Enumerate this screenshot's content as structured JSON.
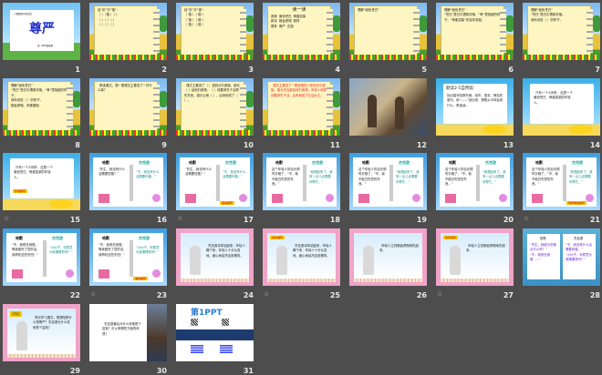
{
  "view": "slide-sorter",
  "animation_icon": "☆",
  "slides": [
    {
      "n": "1",
      "type": "title",
      "title": "尊严",
      "subtitle": "第一PPT模板网",
      "header": "人教版四年级语文"
    },
    {
      "n": "2",
      "type": "notebook",
      "text": "给“饥”字“饿”：\n（ ）（饿 ）（ ）\n（ ）（ ）（ ）\n（ ）（ ）（ ）"
    },
    {
      "n": "3",
      "type": "notebook",
      "text": "给“饥”字“饿”：\n（ 饿 ）（ 饿 ）\n（ 饿 ）（ 饿 ）\n（ 饿 ）（ 饿 ）"
    },
    {
      "n": "4",
      "type": "notebook",
      "heading": "读一读",
      "text": "逃难  面色苍白  骨瘦如柴\n款待  狼吞虎咽  慈祥\n捶背  尊严  庄园"
    },
    {
      "n": "5",
      "type": "notebook",
      "text": "理解“面色苍白”"
    },
    {
      "n": "6",
      "type": "notebook",
      "text": "理解“面色苍白”\n“苍白”是白中透着灰暗，“骨”是指瘦的样子。“骨瘦如柴”形容非常瘦。"
    },
    {
      "n": "7",
      "type": "notebook",
      "text": "理解“面色苍白”\n“苍白”是白中透着灰暗。\n请你说说（ ）的样子。"
    },
    {
      "n": "8",
      "type": "notebook",
      "text": "理解“面色苍白”\n“苍白”是白中透着灰暗，“骨”是指瘦的样子。\n请你说说（ ）的样子。\n狼吞虎咽、风餐露宿。"
    },
    {
      "n": "9",
      "type": "notebook",
      "text": "  默读课文，想一想课文主要讲了一件什么事？"
    },
    {
      "n": "10",
      "type": "notebook",
      "text": "  课文主要讲了（ ）逃到沃尔逊镇，镇长（ ）给他们食物，（ ）却要求先干活再吃东西，镇长让他（ ），后来他成了（ ）。"
    },
    {
      "n": "11",
      "type": "notebook",
      "red": true,
      "text": "  课文主要讲了一群逃难的人来到沃尔逊镇，镇长杰克逊给他们食物，年轻人哈默却要求先干活，后来他成了石油大王。"
    },
    {
      "n": "12",
      "type": "image"
    },
    {
      "n": "13",
      "type": "beach",
      "heading": "默读2-5自然段:",
      "text": "找出描写哈默外貌、动作、语言、神态的语句，用“——”划出来，想想从中体会到什么，再读读。"
    },
    {
      "n": "14",
      "type": "beach",
      "text": "  只有一个人例外，这是一个面色苍白、骨瘦如柴的年轻人。"
    },
    {
      "n": "15",
      "type": "beach",
      "anim": true,
      "tag": "外貌描写",
      "text": "  只有一个人例外，这是一个面色苍白、骨瘦如柴的年轻人。"
    },
    {
      "n": "16",
      "type": "snow",
      "left": "哈默",
      "right": "杰克逊",
      "text": "“先生，我没有什么活需要您做？”",
      "text2": "“不，我没有什么活需要你做。”"
    },
    {
      "n": "17",
      "type": "snow",
      "anim": true,
      "tag": "语言描写",
      "left": "哈默",
      "right": "杰克逊",
      "text": "“先生，我没有什么活需要您做？”",
      "text2": "“不，我没有什么活需要你做。”"
    },
    {
      "n": "18",
      "type": "snow",
      "left": "哈默",
      "right": "杰克逊",
      "text": "这个年轻人的目光顿时灰暗了，“不，我不能白吃您的东西。”",
      "text2": "“我想起来了，我有一点儿活需要你帮忙。”"
    },
    {
      "n": "19",
      "type": "snow",
      "left": "哈默",
      "right": "杰克逊",
      "text": "这个年轻人的目光顿时灰暗了，“不，我不能白吃您的东西。”",
      "text2": "“我想起来了，我有一点儿活需要你帮忙。”"
    },
    {
      "n": "20",
      "type": "snow",
      "left": "哈默",
      "right": "杰克逊",
      "text": "这个年轻人的目光顿时灰暗了，“不，我不能白吃您的东西。”",
      "text2": "“我想起来了，我有一点儿活需要你帮忙。”"
    },
    {
      "n": "21",
      "type": "snow",
      "anim": true,
      "tag": "动作神态描写",
      "left": "哈默",
      "right": "杰克逊",
      "text": "这个年轻人的目光顿时灰暗了，“不，我不能白吃您的东西。”",
      "text2": "“我想起来了，我有一点儿活需要你帮忙。”"
    },
    {
      "n": "22",
      "type": "snow",
      "left": "哈默",
      "right": "杰克逊",
      "text": "“不，我现在就做，等我做完了您的活，我再吃这些东西！”",
      "text2": "“小伙子，你愿意为我捶捶背吗？”"
    },
    {
      "n": "23",
      "type": "snow",
      "anim": true,
      "tag": "语言描写",
      "left": "哈默",
      "right": "杰克逊",
      "text": "“不，我现在就做，等我做完了您的活，我再吃这些东西！”",
      "text2": "“小伙子，你愿意为我捶捶背吗？”"
    },
    {
      "n": "24",
      "type": "pink",
      "text": "  杰克逊将军站起来，年轻人蹲下来，年轻人十分认真地、细心地给杰克逊捶背。"
    },
    {
      "n": "25",
      "type": "pink",
      "anim": true,
      "tag": "动作描写",
      "text": "  杰克逊将军站起来，年轻人蹲下来，年轻人十分认真地、细心地给杰克逊捶背。"
    },
    {
      "n": "26",
      "type": "pink",
      "text": "  年轻人立刻狼吞虎咽地吃起来。"
    },
    {
      "n": "27",
      "type": "pink",
      "anim": true,
      "tag": "动作描写",
      "text": "  年轻人立刻狼吞虎咽地吃起来。"
    },
    {
      "n": "28",
      "type": "frame28",
      "left": "哈默",
      "right": "杰克逊",
      "text": "“先生，我能为您做点什么吗？”\n“不，我现在就做……”",
      "text2": "“不，我没有什么活需要你做。”\n“小伙子，你愿意为我捶捶背吗？”"
    },
    {
      "n": "29",
      "type": "pink",
      "tag": "讨论:",
      "text": "  再次学习课文，想想哈默什么是尊严？杰克逊为什么说他是个富翁？"
    },
    {
      "n": "30",
      "type": "image30",
      "text": "  杰克逊最后为什么说他是个富翁？可以有哪些方面的体现？"
    },
    {
      "n": "31",
      "type": "ppt31",
      "logo": "第1PPT"
    }
  ]
}
